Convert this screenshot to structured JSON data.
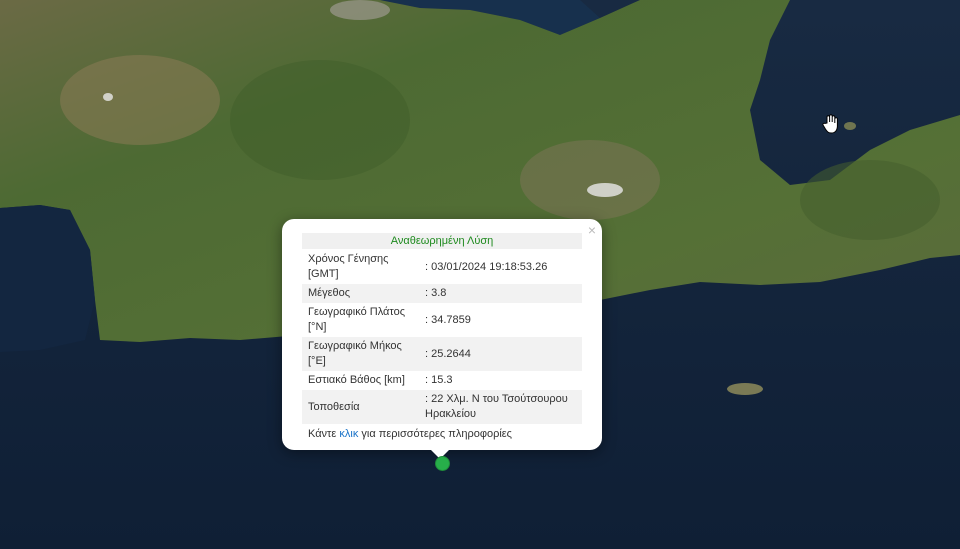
{
  "popup": {
    "title": "Αναθεωρημένη Λύση",
    "close_symbol": "×",
    "rows": [
      {
        "label": "Χρόνος Γένησης [GMT]",
        "value": ": 03/01/2024 19:18:53.26"
      },
      {
        "label": "Μέγεθος",
        "value": ": 3.8"
      },
      {
        "label": "Γεωγραφικό Πλάτος [°N]",
        "value": ": 34.7859"
      },
      {
        "label": "Γεωγραφικό Μήκος [°E]",
        "value": ": 25.2644"
      },
      {
        "label": "Εστιακό Βάθος [km]",
        "value": ": 15.3"
      },
      {
        "label": "Τοποθεσία",
        "value": ": 22 Χλμ. N του Τσούτσουρου Ηρακλείου"
      }
    ],
    "footer_prefix": "Κάντε ",
    "footer_link": "κλικ",
    "footer_suffix": " για περισσότερες πληροφορίες"
  },
  "colors": {
    "sea": "#12243c",
    "land": "#4f6a34",
    "marker": "#27ae4a",
    "title_text": "#1e8a1e",
    "link": "#1a73c8"
  },
  "icons": {
    "epicenter": "epicenter-marker-icon",
    "cursor": "hand-cursor-icon"
  }
}
